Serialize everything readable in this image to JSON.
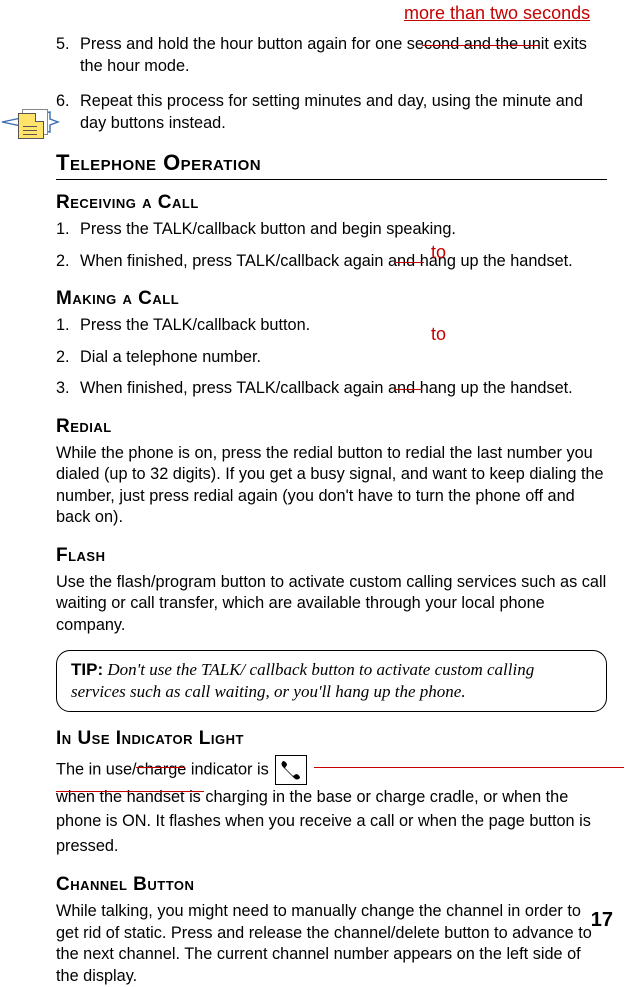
{
  "annotations": {
    "more_than_two_seconds": "more than two seconds",
    "to1": "to",
    "to2": "to"
  },
  "steps_top": {
    "s5_num": "5.",
    "s5_a": "Press and hold the hour button again for ",
    "s5_strike": "one second and",
    "s5_b": " the unit exits the hour mode.",
    "s6_num": "6.",
    "s6": "Repeat this process for setting minutes and day, using the minute and day buttons instead."
  },
  "h_tel_op": "Telephone Operation",
  "recv": {
    "h": "Receiving a Call",
    "s1n": "1.",
    "s1": "Press the TALK/callback button and begin speaking.",
    "s2n": "2.",
    "s2a": "When finished, press TALK/callback again ",
    "s2s": "and",
    "s2b": " hang up the handset."
  },
  "make": {
    "h": "Making a Call",
    "s1n": "1.",
    "s1": "Press the TALK/callback button.",
    "s2n": "2.",
    "s2": "Dial a telephone number.",
    "s3n": "3.",
    "s3a": "When finished, press TALK/callback again ",
    "s3s": "and",
    "s3b": " hang up the handset."
  },
  "redial": {
    "h": "Redial",
    "p": "While the phone is on, press the redial button to redial the last number you dialed (up to 32 digits). If you get a busy signal, and want to keep dialing the number, just press redial again (you don't have to turn the phone off and back on)."
  },
  "flash": {
    "h": "Flash",
    "p": "Use the flash/program button to activate custom calling services such as call waiting or call transfer, which are available through your local phone company."
  },
  "tip": {
    "label": "TIP:",
    "text": " Don't use the TALK/ callback button to activate custom calling services such as call waiting, or you'll hang up the phone."
  },
  "inuse": {
    "h": "In Use Indicator Light",
    "a": "The in use",
    "slash": "/",
    "charge_strike": "charge",
    "b": " indicator is ",
    "strike_long": "when the handset is charging in the base or charge cradle, or",
    "c": " when the phone is ON. It flashes when you receive a call or when the page button is pressed."
  },
  "channel": {
    "h": "Channel Button",
    "p": "While talking, you might need to manually change the channel in order to get rid of static. Press and release the channel/delete button to advance to the next channel. The current channel number appears on the left side of the display."
  },
  "page": "17"
}
